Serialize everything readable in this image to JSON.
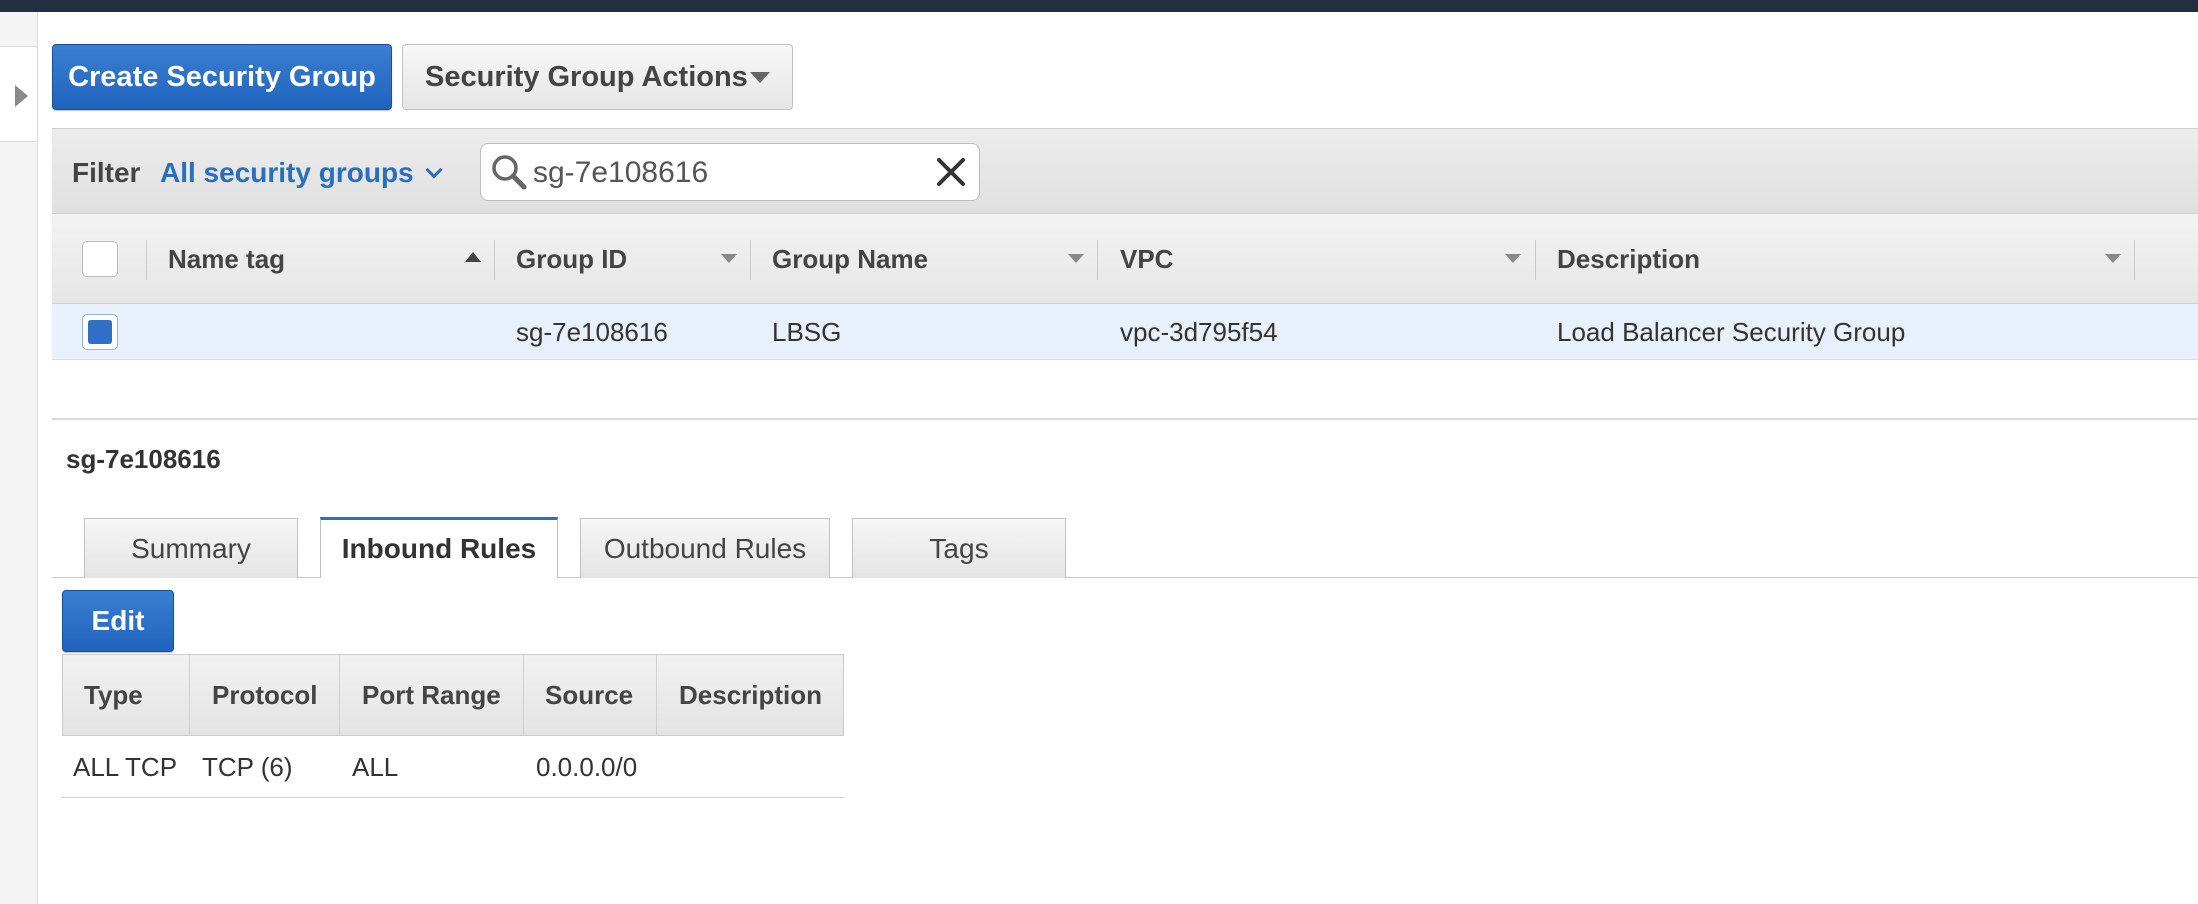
{
  "toolbar": {
    "create_label": "Create Security Group",
    "actions_label": "Security Group Actions"
  },
  "filter": {
    "label": "Filter",
    "selected": "All security groups",
    "search_value": "sg-7e108616"
  },
  "grid": {
    "columns": [
      "Name tag",
      "Group ID",
      "Group Name",
      "VPC",
      "Description"
    ],
    "rows": [
      {
        "name_tag": "",
        "group_id": "sg-7e108616",
        "group_name": "LBSG",
        "vpc": "vpc-3d795f54",
        "description": "Load Balancer Security Group",
        "selected": true
      }
    ]
  },
  "detail": {
    "title": "sg-7e108616",
    "tabs": [
      "Summary",
      "Inbound Rules",
      "Outbound Rules",
      "Tags"
    ],
    "active_tab": "Inbound Rules",
    "edit_label": "Edit",
    "rules_columns": [
      "Type",
      "Protocol",
      "Port Range",
      "Source",
      "Description"
    ],
    "rules": [
      {
        "type": "ALL TCP",
        "protocol": "TCP (6)",
        "port_range": "ALL",
        "source": "0.0.0.0/0",
        "description": ""
      }
    ]
  },
  "colors": {
    "accent": "#2a6fbe",
    "primary_button": "#2063bd",
    "selected_row": "#e8f1fb",
    "top_bar": "#232f3e"
  },
  "icons": [
    "expand-panel-icon",
    "search-icon",
    "clear-icon",
    "dropdown-caret-icon",
    "sort-ascending-icon",
    "sort-caret-icon"
  ]
}
